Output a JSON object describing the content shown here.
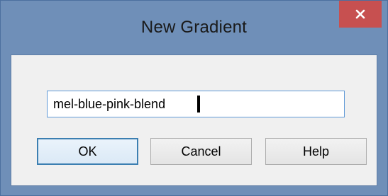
{
  "window": {
    "title": "New Gradient"
  },
  "name_field": {
    "value": "mel-blue-pink-blend"
  },
  "buttons": {
    "ok": "OK",
    "cancel": "Cancel",
    "help": "Help"
  },
  "colors": {
    "titlebar": "#6f8fb8",
    "close_button": "#c75050",
    "dialog_body": "#f0f0f0",
    "focus_border": "#3c7fb1"
  },
  "icons": {
    "close": "close-icon"
  }
}
